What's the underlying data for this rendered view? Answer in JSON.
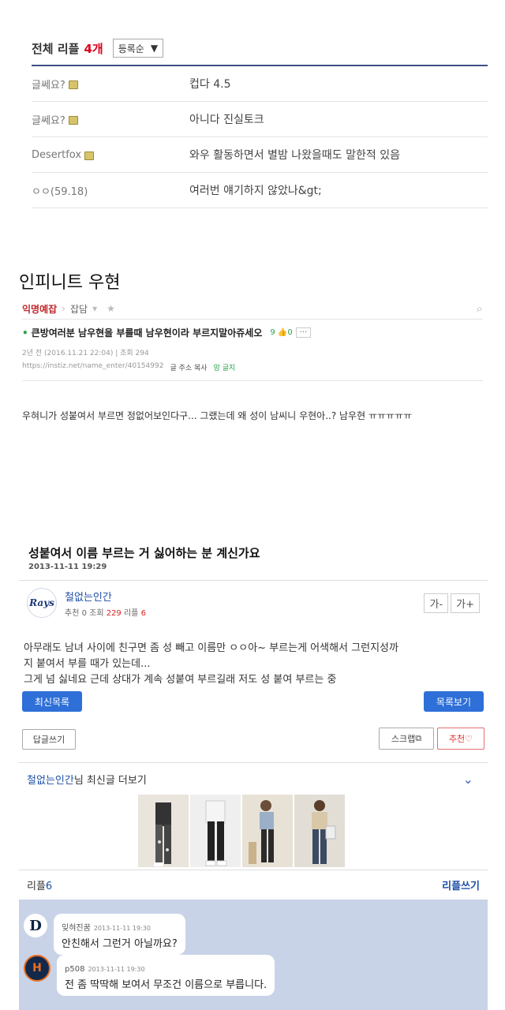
{
  "replies_section": {
    "title": "전체 리플",
    "count": "4개",
    "sort_label": "등록순",
    "rows": [
      {
        "nick": "글쎄요?",
        "text": "컵다 4.5"
      },
      {
        "nick": "글쎄요?",
        "text": "아니다 진실토크"
      },
      {
        "nick": "Desertfox",
        "text": "와우 활동하면서 별밤 나왔을때도 말한적 있음"
      },
      {
        "nick": "ㅇㅇ(59.18)",
        "text": "여러번 얘기하지 않았나&gt;"
      }
    ]
  },
  "infinite": {
    "heading": "인피니트 우현",
    "board": "익명예잡",
    "category": "잡담",
    "post_title": "큰방여러분 남우현을 부를때 남우현이라 부르지말아쥬세오",
    "comment_info": "9 👍0",
    "more": "···",
    "meta": "2년 전 (2016.11.21 22:04) | 조회 294",
    "url": "https://instiz.net/name_enter/40154992",
    "copy_label": "글 주소 복사",
    "rules_label": "맘 글지",
    "body": "우혀니가 성붙여서 부르면 정없어보인다구... 그랬는데 왜 성이 남씨니 우현아..? 남우현 ㅠㅠㅠㅠㅠ"
  },
  "board_post": {
    "title": "성붙여서 이름 부르는 거 싫어하는 분 계신가요",
    "date": "2013-11-11 19:29",
    "author": "철없는인간",
    "avatar_text": "Rays",
    "stats_prefix": "추천 0 조회 ",
    "views": "229",
    "stats_mid": " 리플 ",
    "reply_count": "6",
    "font_minus": "가-",
    "font_plus": "가+",
    "body_line1": "아무래도 남녀 사이에 친구면 좀 성 빼고 이름만 ㅇㅇ아~ 부르는게 어색해서 그런지성까",
    "body_line2": "지 붙여서 부를 때가 있는데...",
    "body_line3": "그게 넘 싫네요 근데 상대가 계속 성붙여 부르길래 저도 성 붙여 부르는 중",
    "btn_latest": "최신목록",
    "btn_list": "목록보기",
    "btn_reply": "답글쓰기",
    "btn_scrap": "스크랩",
    "btn_recommend": "추천♡",
    "more_name": "철없는인간",
    "more_text": "님 최신글 더보기",
    "reply_label": "리플",
    "reply_num": "6",
    "reply_write": "리플쓰기"
  },
  "comments": [
    {
      "nick": "잊혀진꿈",
      "time": "2013-11-11 19:30",
      "text": "안친해서 그런거 아닐까요?",
      "avatar": "D"
    },
    {
      "nick": "p508",
      "time": "2013-11-11 19:30",
      "text": "전 좀 딱딱해 보여서 무조건 이름으로 부릅니다.",
      "avatar": "H"
    }
  ],
  "colors": {
    "accent_blue": "#2e6fd8",
    "link_blue": "#1f4fa8",
    "red": "#d9001b",
    "green": "#2aa34a",
    "reply_bg": "#c9d3e8"
  }
}
